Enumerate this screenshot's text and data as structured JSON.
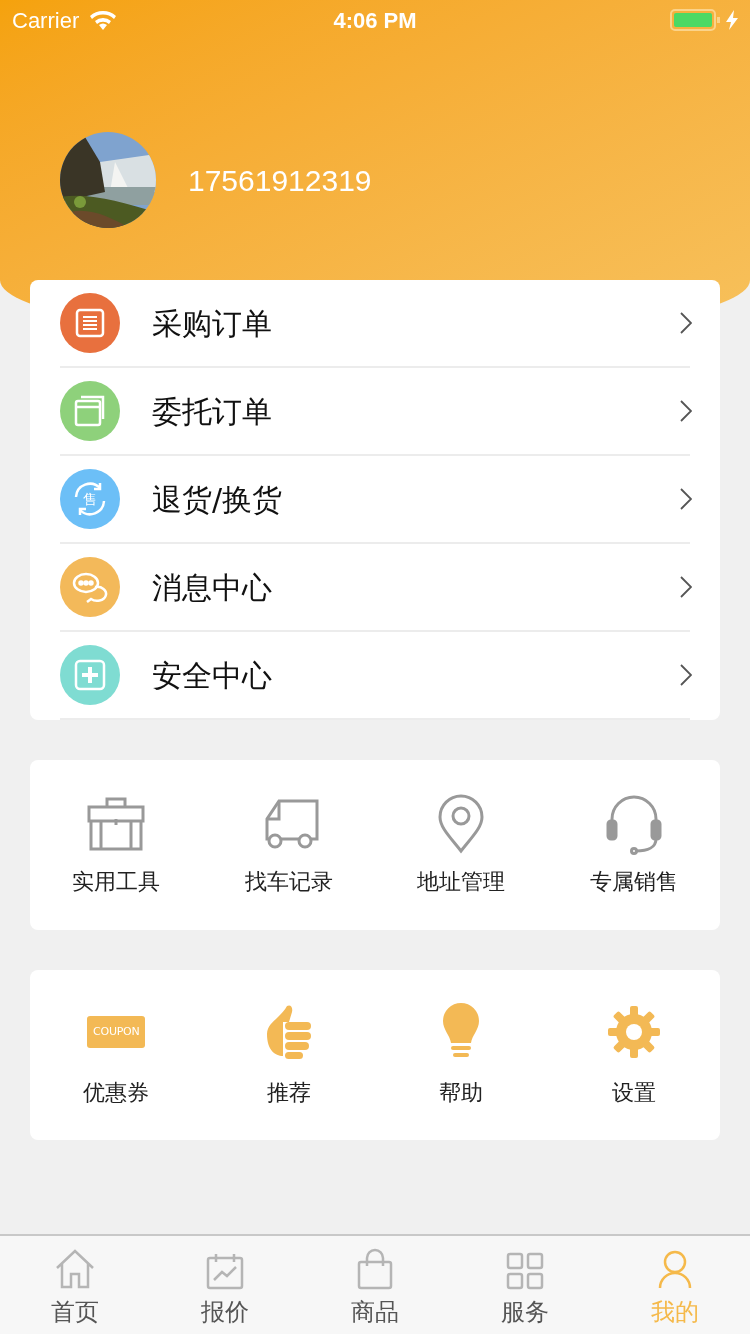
{
  "status_bar": {
    "carrier": "Carrier",
    "time": "4:06 PM"
  },
  "profile": {
    "phone": "17561912319"
  },
  "menu": [
    {
      "label": "采购订单",
      "color": "#e8703e"
    },
    {
      "label": "委托订单",
      "color": "#8ed17b"
    },
    {
      "label": "退货/换货",
      "color": "#6cbff7",
      "icon_text": "售"
    },
    {
      "label": "消息中心",
      "color": "#f3b95a"
    },
    {
      "label": "安全中心",
      "color": "#7fdcd2"
    }
  ],
  "tools": [
    {
      "label": "实用工具"
    },
    {
      "label": "找车记录"
    },
    {
      "label": "地址管理"
    },
    {
      "label": "专属销售"
    }
  ],
  "more": [
    {
      "label": "优惠券",
      "icon_text": "COUPON"
    },
    {
      "label": "推荐"
    },
    {
      "label": "帮助"
    },
    {
      "label": "设置"
    }
  ],
  "tab_bar": [
    {
      "label": "首页",
      "selected": false
    },
    {
      "label": "报价",
      "selected": false
    },
    {
      "label": "商品",
      "selected": false
    },
    {
      "label": "服务",
      "selected": false
    },
    {
      "label": "我的",
      "selected": true
    }
  ]
}
